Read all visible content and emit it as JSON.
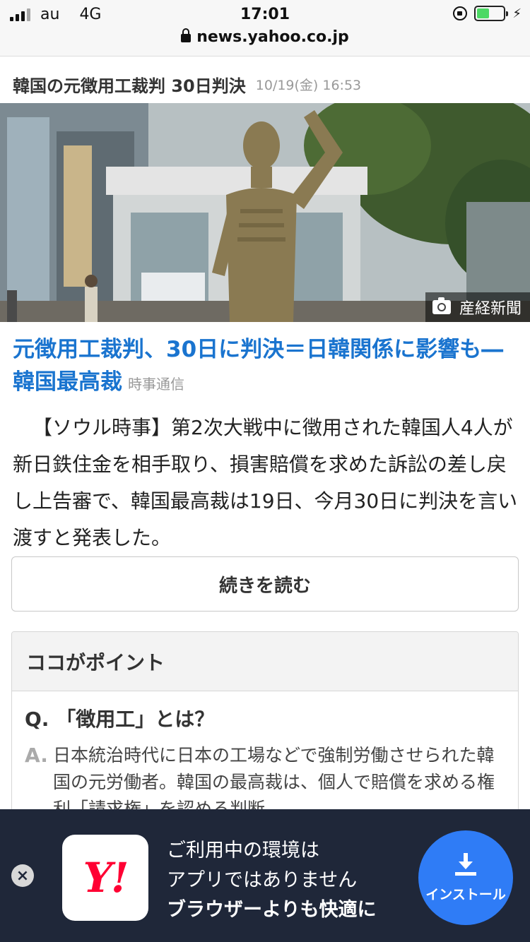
{
  "status_bar": {
    "carrier": "au",
    "network": "4G",
    "time": "17:01"
  },
  "browser": {
    "url": "news.yahoo.co.jp"
  },
  "topic": {
    "title": "韓国の元徴用工裁判 30日判決",
    "date": "10/19(金) 16:53"
  },
  "photo": {
    "credit": "産経新聞"
  },
  "article": {
    "headline": "元徴用工裁判、30日に判決＝日韓関係に影響も―韓国最高裁",
    "source": "時事通信",
    "body": "【ソウル時事】第2次大戦中に徴用された韓国人4人が新日鉄住金を相手取り、損害賠償を求めた訴訟の差し戻し上告審で、韓国最高裁は19日、今月30日に判決を言い渡すと発表した。"
  },
  "read_more_label": "続きを読む",
  "point_box": {
    "title": "ココがポイント",
    "question": "Q. 「徴用工」とは？",
    "answer_label": "A.",
    "answer": "日本統治時代に日本の工場などで強制労働させられた韓国の元労働者。韓国の最高裁は、個人で賠償を求める権利「請求権」を認める判断"
  },
  "app_banner": {
    "close": "×",
    "logo": "Y!",
    "line1": "ご利用中の環境は",
    "line2": "アプリではありません",
    "line3": "ブラウザーよりも快適に",
    "install_label": "インストール"
  }
}
